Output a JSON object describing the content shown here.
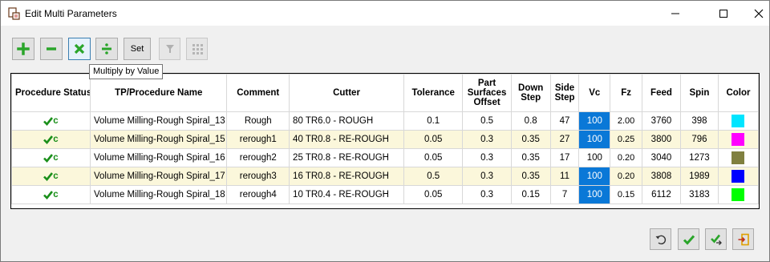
{
  "window": {
    "title": "Edit Multi Parameters",
    "icons": {
      "app": "app-icon",
      "minimize": "minimize-icon",
      "maximize": "maximize-icon",
      "close": "close-icon"
    }
  },
  "toolbar": {
    "buttons": [
      {
        "icon": "plus-icon",
        "color": "#2aa52a"
      },
      {
        "icon": "minus-icon",
        "color": "#2aa52a"
      },
      {
        "icon": "multiply-icon",
        "color": "#2aa52a"
      },
      {
        "icon": "divide-icon",
        "color": "#2aa52a"
      },
      {
        "label": "Set"
      },
      {
        "icon": "filter-icon"
      },
      {
        "icon": "grid-icon"
      }
    ],
    "tooltip": "Multiply by Value"
  },
  "table": {
    "headers": {
      "status": "Procedure Status",
      "name": "TP/Procedure Name",
      "comment": "Comment",
      "cutter": "Cutter",
      "tolerance": "Tolerance",
      "offset": "Part Surfaces Offset",
      "down": "Down Step",
      "side": "Side Step",
      "vc": "Vc",
      "fz": "Fz",
      "feed": "Feed",
      "spin": "Spin",
      "color": "Color"
    },
    "rows": [
      {
        "status": "c",
        "name": "Volume Milling-Rough Spiral_13",
        "comment": "Rough",
        "cutter": "80 TR6.0 - ROUGH",
        "tolerance": "0.1",
        "offset": "0.5",
        "down": "0.8",
        "side": "47",
        "vc": "100",
        "vc_highlight": true,
        "fz": "2.00",
        "feed": "3760",
        "spin": "398",
        "color": "#00e5ff"
      },
      {
        "status": "c",
        "name": "Volume Milling-Rough Spiral_15",
        "comment": "rerough1",
        "cutter": "40 TR0.8 - RE-ROUGH",
        "tolerance": "0.05",
        "offset": "0.3",
        "down": "0.35",
        "side": "27",
        "vc": "100",
        "vc_highlight": true,
        "fz": "0.25",
        "feed": "3800",
        "spin": "796",
        "color": "#ff00ff"
      },
      {
        "status": "c",
        "name": "Volume Milling-Rough Spiral_16",
        "comment": "rerough2",
        "cutter": "25 TR0.8 - RE-ROUGH",
        "tolerance": "0.05",
        "offset": "0.3",
        "down": "0.35",
        "side": "17",
        "vc": "100",
        "vc_highlight": false,
        "fz": "0.20",
        "feed": "3040",
        "spin": "1273",
        "color": "#808040"
      },
      {
        "status": "c",
        "name": "Volume Milling-Rough Spiral_17",
        "comment": "rerough3",
        "cutter": "16 TR0.8 - RE-ROUGH",
        "tolerance": "0.5",
        "offset": "0.3",
        "down": "0.35",
        "side": "11",
        "vc": "100",
        "vc_highlight": true,
        "fz": "0.20",
        "feed": "3808",
        "spin": "1989",
        "color": "#0000ff"
      },
      {
        "status": "c",
        "name": "Volume Milling-Rough Spiral_18",
        "comment": "rerough4",
        "cutter": "10 TR0.4 - RE-ROUGH",
        "tolerance": "0.05",
        "offset": "0.3",
        "down": "0.15",
        "side": "7",
        "vc": "100",
        "vc_highlight": true,
        "fz": "0.15",
        "feed": "6112",
        "spin": "3183",
        "color": "#00ff00"
      }
    ]
  },
  "footer": {
    "buttons": [
      {
        "icon": "undo-icon"
      },
      {
        "icon": "ok-check-icon",
        "color": "#2aa52a"
      },
      {
        "icon": "apply-check-icon",
        "color": "#2aa52a"
      },
      {
        "icon": "exit-icon",
        "color": "#e0a000"
      }
    ]
  }
}
